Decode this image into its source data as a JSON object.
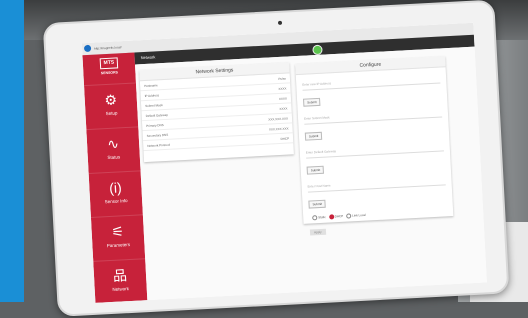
{
  "browser": {
    "url": "http://magnetic.local/"
  },
  "app": {
    "logo_mark": "MTS",
    "logo_sub": "SENSORS",
    "page_title": "Network"
  },
  "sidebar": {
    "items": [
      {
        "label": "Setup",
        "icon": "gear-icon",
        "glyph": "⚙"
      },
      {
        "label": "Status",
        "icon": "pulse-icon",
        "glyph": "∿"
      },
      {
        "label": "Sensor Info",
        "icon": "info-icon",
        "glyph": "(i)"
      },
      {
        "label": "Parameters",
        "icon": "sliders-icon",
        "glyph": "⚟"
      },
      {
        "label": "Network",
        "icon": "network-icon",
        "glyph": "品"
      }
    ]
  },
  "network_settings": {
    "title": "Network Settings",
    "rows": [
      {
        "key": "Hostname",
        "value": "Pulse"
      },
      {
        "key": "IP Address",
        "value": "XXXX"
      },
      {
        "key": "Subnet Mask",
        "value": "XXXX"
      },
      {
        "key": "Default Gateway",
        "value": "XXXX"
      },
      {
        "key": "Primary DNS",
        "value": "XXX.XXX.XXX"
      },
      {
        "key": "Secondary DNS",
        "value": "XXX.XXX.XXX"
      },
      {
        "key": "Network Protocol",
        "value": "DHCP"
      }
    ]
  },
  "configure": {
    "title": "Configure",
    "fields": [
      {
        "placeholder": "Enter new IP Address",
        "button": "Submit"
      },
      {
        "placeholder": "Enter Subnet Mask",
        "button": "Submit"
      },
      {
        "placeholder": "Enter Default Gateway",
        "button": "Submit"
      },
      {
        "placeholder": "Enter Host Name",
        "button": "Submit"
      }
    ],
    "radios": [
      {
        "label": "Static",
        "selected": false
      },
      {
        "label": "DHCP",
        "selected": true
      },
      {
        "label": "Link Local",
        "selected": false
      }
    ],
    "apply_label": "Apply"
  }
}
